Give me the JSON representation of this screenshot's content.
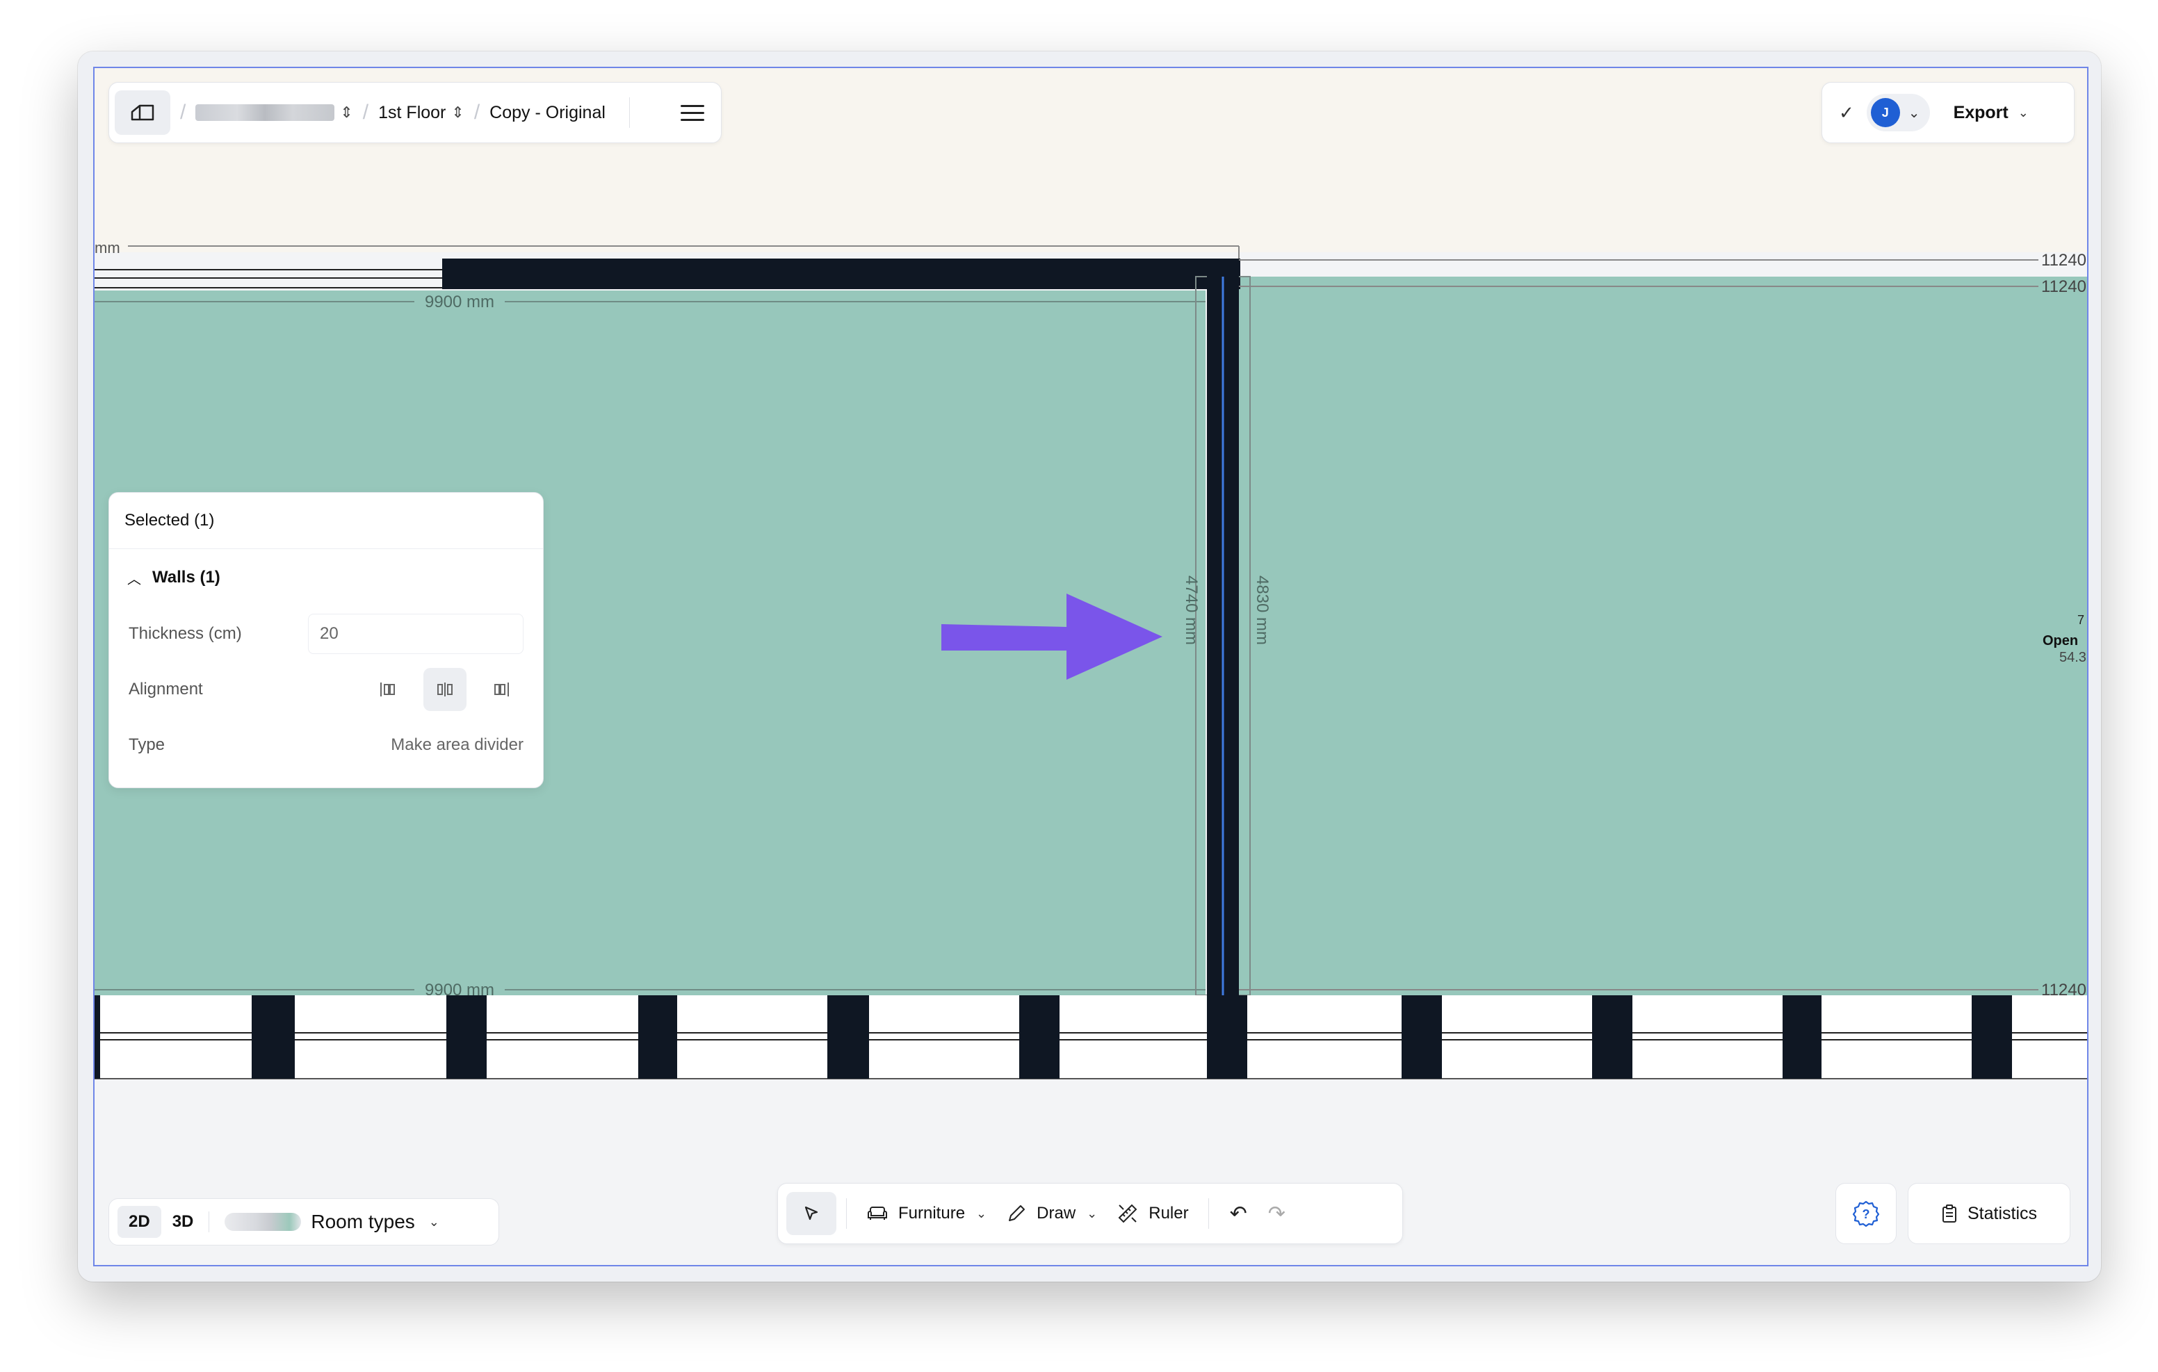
{
  "topbar": {
    "floor_label": "1st Floor",
    "version_label": "Copy - Original",
    "user_initial": "J",
    "export_label": "Export"
  },
  "canvas": {
    "unit_fragment": "mm",
    "dim_top": "9900 mm",
    "dim_bottom": "9900 mm",
    "dim_wall_left": "4740 mm",
    "dim_wall_right": "4830 mm",
    "dim_right_1": "11240",
    "dim_right_2": "11240",
    "dim_right_3": "11240",
    "room_label_line1": "Open",
    "room_label_line2": "54.3",
    "room_label_extra": "7",
    "colors": {
      "floor": "#97c7bb",
      "wall": "#0f1723",
      "selection": "#3f7be0",
      "arrow": "#7a55ea",
      "outside": "#f8f5ef"
    }
  },
  "panel": {
    "title": "Selected (1)",
    "group_label": "Walls (1)",
    "thickness_label": "Thickness (cm)",
    "thickness_value": "20",
    "alignment_label": "Alignment",
    "type_label": "Type",
    "type_value": "Make area divider"
  },
  "view": {
    "mode_2d": "2D",
    "mode_3d": "3D",
    "room_types_label": "Room types"
  },
  "toolbar": {
    "furniture_label": "Furniture",
    "draw_label": "Draw",
    "ruler_label": "Ruler"
  },
  "statistics_label": "Statistics"
}
